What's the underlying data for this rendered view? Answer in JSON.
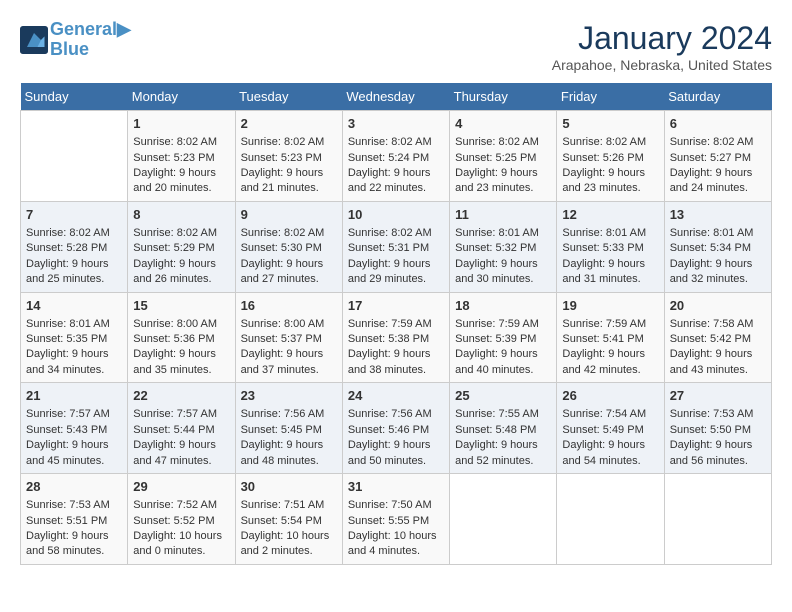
{
  "header": {
    "logo_line1": "General",
    "logo_line2": "Blue",
    "month_title": "January 2024",
    "location": "Arapahoe, Nebraska, United States"
  },
  "weekdays": [
    "Sunday",
    "Monday",
    "Tuesday",
    "Wednesday",
    "Thursday",
    "Friday",
    "Saturday"
  ],
  "weeks": [
    [
      {
        "day": "",
        "content": ""
      },
      {
        "day": "1",
        "content": "Sunrise: 8:02 AM\nSunset: 5:23 PM\nDaylight: 9 hours\nand 20 minutes."
      },
      {
        "day": "2",
        "content": "Sunrise: 8:02 AM\nSunset: 5:23 PM\nDaylight: 9 hours\nand 21 minutes."
      },
      {
        "day": "3",
        "content": "Sunrise: 8:02 AM\nSunset: 5:24 PM\nDaylight: 9 hours\nand 22 minutes."
      },
      {
        "day": "4",
        "content": "Sunrise: 8:02 AM\nSunset: 5:25 PM\nDaylight: 9 hours\nand 23 minutes."
      },
      {
        "day": "5",
        "content": "Sunrise: 8:02 AM\nSunset: 5:26 PM\nDaylight: 9 hours\nand 23 minutes."
      },
      {
        "day": "6",
        "content": "Sunrise: 8:02 AM\nSunset: 5:27 PM\nDaylight: 9 hours\nand 24 minutes."
      }
    ],
    [
      {
        "day": "7",
        "content": "Sunrise: 8:02 AM\nSunset: 5:28 PM\nDaylight: 9 hours\nand 25 minutes."
      },
      {
        "day": "8",
        "content": "Sunrise: 8:02 AM\nSunset: 5:29 PM\nDaylight: 9 hours\nand 26 minutes."
      },
      {
        "day": "9",
        "content": "Sunrise: 8:02 AM\nSunset: 5:30 PM\nDaylight: 9 hours\nand 27 minutes."
      },
      {
        "day": "10",
        "content": "Sunrise: 8:02 AM\nSunset: 5:31 PM\nDaylight: 9 hours\nand 29 minutes."
      },
      {
        "day": "11",
        "content": "Sunrise: 8:01 AM\nSunset: 5:32 PM\nDaylight: 9 hours\nand 30 minutes."
      },
      {
        "day": "12",
        "content": "Sunrise: 8:01 AM\nSunset: 5:33 PM\nDaylight: 9 hours\nand 31 minutes."
      },
      {
        "day": "13",
        "content": "Sunrise: 8:01 AM\nSunset: 5:34 PM\nDaylight: 9 hours\nand 32 minutes."
      }
    ],
    [
      {
        "day": "14",
        "content": "Sunrise: 8:01 AM\nSunset: 5:35 PM\nDaylight: 9 hours\nand 34 minutes."
      },
      {
        "day": "15",
        "content": "Sunrise: 8:00 AM\nSunset: 5:36 PM\nDaylight: 9 hours\nand 35 minutes."
      },
      {
        "day": "16",
        "content": "Sunrise: 8:00 AM\nSunset: 5:37 PM\nDaylight: 9 hours\nand 37 minutes."
      },
      {
        "day": "17",
        "content": "Sunrise: 7:59 AM\nSunset: 5:38 PM\nDaylight: 9 hours\nand 38 minutes."
      },
      {
        "day": "18",
        "content": "Sunrise: 7:59 AM\nSunset: 5:39 PM\nDaylight: 9 hours\nand 40 minutes."
      },
      {
        "day": "19",
        "content": "Sunrise: 7:59 AM\nSunset: 5:41 PM\nDaylight: 9 hours\nand 42 minutes."
      },
      {
        "day": "20",
        "content": "Sunrise: 7:58 AM\nSunset: 5:42 PM\nDaylight: 9 hours\nand 43 minutes."
      }
    ],
    [
      {
        "day": "21",
        "content": "Sunrise: 7:57 AM\nSunset: 5:43 PM\nDaylight: 9 hours\nand 45 minutes."
      },
      {
        "day": "22",
        "content": "Sunrise: 7:57 AM\nSunset: 5:44 PM\nDaylight: 9 hours\nand 47 minutes."
      },
      {
        "day": "23",
        "content": "Sunrise: 7:56 AM\nSunset: 5:45 PM\nDaylight: 9 hours\nand 48 minutes."
      },
      {
        "day": "24",
        "content": "Sunrise: 7:56 AM\nSunset: 5:46 PM\nDaylight: 9 hours\nand 50 minutes."
      },
      {
        "day": "25",
        "content": "Sunrise: 7:55 AM\nSunset: 5:48 PM\nDaylight: 9 hours\nand 52 minutes."
      },
      {
        "day": "26",
        "content": "Sunrise: 7:54 AM\nSunset: 5:49 PM\nDaylight: 9 hours\nand 54 minutes."
      },
      {
        "day": "27",
        "content": "Sunrise: 7:53 AM\nSunset: 5:50 PM\nDaylight: 9 hours\nand 56 minutes."
      }
    ],
    [
      {
        "day": "28",
        "content": "Sunrise: 7:53 AM\nSunset: 5:51 PM\nDaylight: 9 hours\nand 58 minutes."
      },
      {
        "day": "29",
        "content": "Sunrise: 7:52 AM\nSunset: 5:52 PM\nDaylight: 10 hours\nand 0 minutes."
      },
      {
        "day": "30",
        "content": "Sunrise: 7:51 AM\nSunset: 5:54 PM\nDaylight: 10 hours\nand 2 minutes."
      },
      {
        "day": "31",
        "content": "Sunrise: 7:50 AM\nSunset: 5:55 PM\nDaylight: 10 hours\nand 4 minutes."
      },
      {
        "day": "",
        "content": ""
      },
      {
        "day": "",
        "content": ""
      },
      {
        "day": "",
        "content": ""
      }
    ]
  ]
}
